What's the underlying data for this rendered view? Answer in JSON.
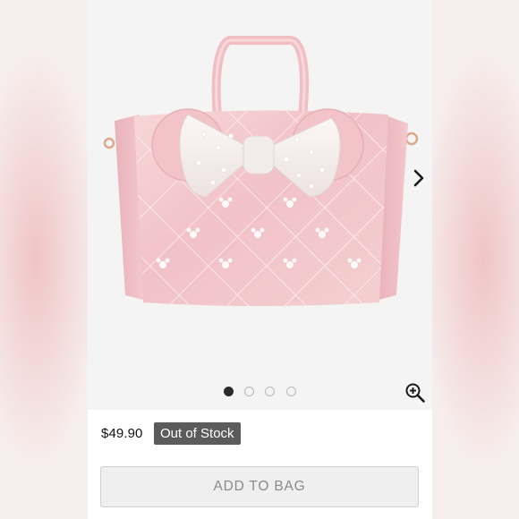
{
  "product": {
    "price": "$49.90",
    "stock_status": "Out of Stock",
    "image_alt": "Pink iridescent tote bag with white bow",
    "colors": {
      "bag_pink": "#f2c6c9",
      "bow_white": "#f7f2f1",
      "badge_gray": "#5b5b5b"
    }
  },
  "gallery": {
    "slide_count": 4,
    "active_slide": 1,
    "dots": [
      {
        "active": true
      },
      {
        "active": false
      },
      {
        "active": false
      },
      {
        "active": false
      }
    ],
    "next_icon": "chevron-right-icon",
    "zoom_icon": "zoom-in-icon"
  },
  "actions": {
    "add_to_bag_label": "ADD TO BAG"
  }
}
